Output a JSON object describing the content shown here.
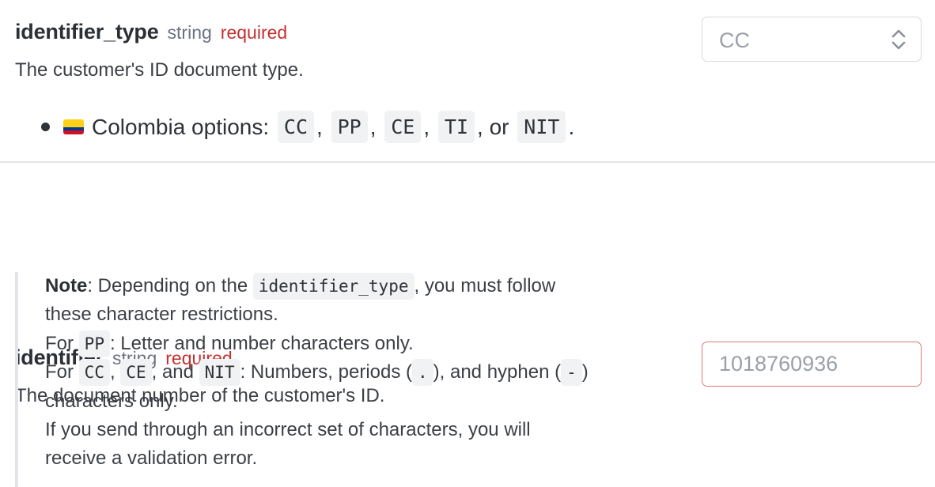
{
  "params": [
    {
      "name": "identifier_type",
      "type": "string",
      "required": "required",
      "description": "The customer's ID document type.",
      "bullet": {
        "flag_icon": "colombia-flag-icon",
        "lead": "Colombia options:",
        "options": [
          "CC",
          "PP",
          "CE",
          "TI",
          "NIT"
        ],
        "sep": ",",
        "or_text": "or",
        "end": "."
      },
      "control": {
        "kind": "select",
        "value": "CC",
        "icon": "chevron-up-down-icon"
      }
    },
    {
      "name": "identifier",
      "type": "string",
      "required": "required",
      "description": "The document number of the customer's ID.",
      "control": {
        "kind": "input",
        "placeholder": "1018760936"
      },
      "note": {
        "label": "Note",
        "line1_a": ": Depending on the ",
        "line1_code": "identifier_type",
        "line1_b": ", you must follow",
        "line2": "these character restrictions.",
        "line3_a": "For ",
        "line3_code": "PP",
        "line3_b": ": Letter and number characters only.",
        "line4_a": "For ",
        "line4_code1": "CC",
        "line4_sep": ", ",
        "line4_code2": "CE",
        "line4_and": ", and ",
        "line4_code3": "NIT",
        "line4_b": ": Numbers, periods (",
        "line4_code4": ".",
        "line4_c": "), and hyphen (",
        "line4_code5": "-",
        "line4_d": ")",
        "line5": "characters only.",
        "line6": "If you send through an incorrect set of characters, you will",
        "line7": "receive a validation error."
      }
    }
  ],
  "colors": {
    "required": "#c53030",
    "type": "#6b7280",
    "error_border": "#d97b7b",
    "code_bg": "#f1f2f4"
  }
}
